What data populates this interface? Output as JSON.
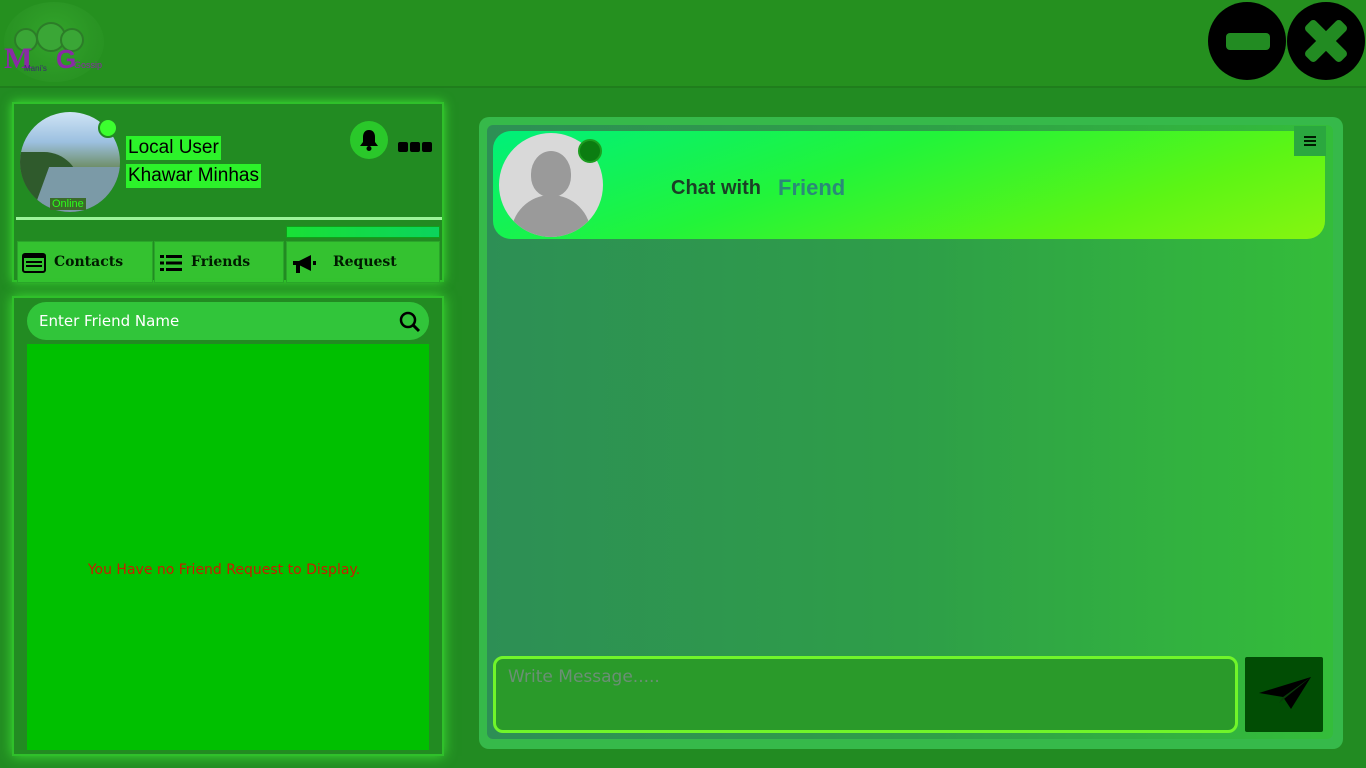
{
  "app": {
    "logo_letter_m": "M",
    "logo_letter_g": "G",
    "logo_text_1": "Mani's",
    "logo_text_2": "Gossip"
  },
  "window": {
    "minimize_icon": "minimize-icon",
    "close_icon": "close-icon"
  },
  "profile": {
    "status": "Online",
    "account_type": "Local User",
    "name": "Khawar Minhas",
    "status_color": "#3cff2f"
  },
  "tabs": [
    {
      "label": "Contacts",
      "icon": "contacts-card-icon"
    },
    {
      "label": "Friends",
      "icon": "list-icon"
    },
    {
      "label": "Request",
      "icon": "megaphone-icon"
    }
  ],
  "search": {
    "placeholder": "Enter Friend Name"
  },
  "list": {
    "empty_message": "You Have no Friend Request to Display."
  },
  "chat": {
    "chat_with_label": "Chat with",
    "friend_name": "Friend",
    "message_placeholder": "Write Message.....",
    "friend_status_color": "#0b7d11"
  },
  "colors": {
    "accent": "#3de034",
    "background": "#228b22",
    "error_text": "#c81e00"
  }
}
